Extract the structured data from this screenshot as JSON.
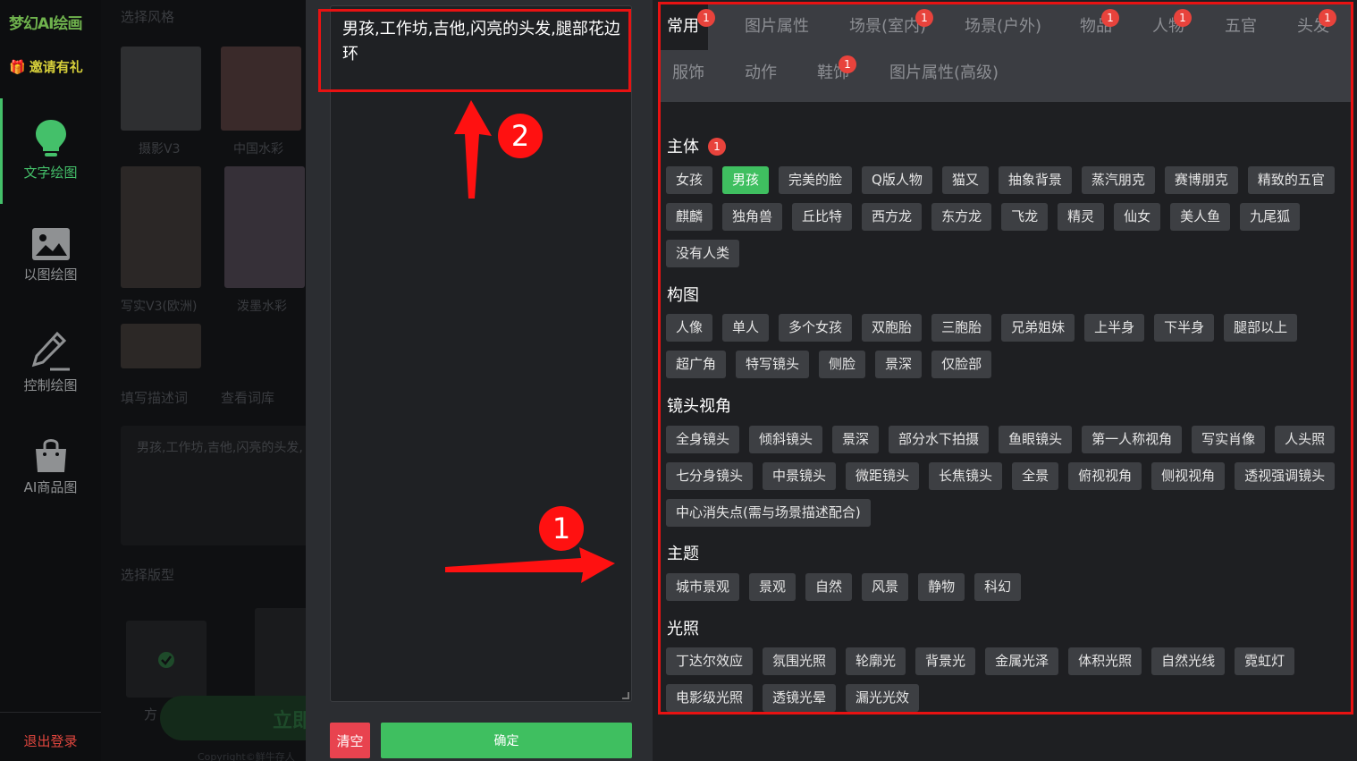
{
  "sidebar": {
    "logo": "梦幻AI绘画",
    "invite": "邀请有礼",
    "items": [
      {
        "label": "文字绘图",
        "icon": "lightbulb-icon"
      },
      {
        "label": "以图绘图",
        "icon": "image-icon"
      },
      {
        "label": "控制绘图",
        "icon": "pencil-icon"
      },
      {
        "label": "AI商品图",
        "icon": "shopping-bag-icon"
      }
    ],
    "logout": "退出登录"
  },
  "background": {
    "select_style": "选择风格",
    "styles": [
      "摄影V3",
      "中国水彩",
      "写实V3(欧洲)",
      "泼墨水彩"
    ],
    "fill_desc": "填写描述词",
    "view_lexicon": "查看词库",
    "prompt_preview": "男孩,工作坊,吉他,闪亮的头发,",
    "select_layout": "选择版型",
    "layout_option": "方",
    "generate_btn": "立即",
    "copyright": "Copyright©鲜牛存人"
  },
  "editor": {
    "prompt": "男孩,工作坊,吉他,闪亮的头发,腿部花边环",
    "clear": "清空",
    "confirm": "确定"
  },
  "tabs": [
    {
      "label": "常用",
      "badge": "1",
      "active": true
    },
    {
      "label": "图片属性"
    },
    {
      "label": "场景(室内)",
      "badge": "1"
    },
    {
      "label": "场景(户外)"
    },
    {
      "label": "物品",
      "badge": "1"
    },
    {
      "label": "人物",
      "badge": "1"
    },
    {
      "label": "五官"
    },
    {
      "label": "头发",
      "badge": "1"
    },
    {
      "label": "服饰"
    },
    {
      "label": "动作"
    },
    {
      "label": "鞋饰",
      "badge": "1"
    },
    {
      "label": "图片属性(高级)"
    }
  ],
  "sections": [
    {
      "title": "主体",
      "badge": "1",
      "selected": "男孩",
      "tags": [
        "女孩",
        "男孩",
        "完美的脸",
        "Q版人物",
        "猫又",
        "抽象背景",
        "蒸汽朋克",
        "赛博朋克",
        "精致的五官",
        "麒麟",
        "独角兽",
        "丘比特",
        "西方龙",
        "东方龙",
        "飞龙",
        "精灵",
        "仙女",
        "美人鱼",
        "九尾狐",
        "没有人类"
      ]
    },
    {
      "title": "构图",
      "tags": [
        "人像",
        "单人",
        "多个女孩",
        "双胞胎",
        "三胞胎",
        "兄弟姐妹",
        "上半身",
        "下半身",
        "腿部以上",
        "超广角",
        "特写镜头",
        "侧脸",
        "景深",
        "仅脸部"
      ]
    },
    {
      "title": "镜头视角",
      "tags": [
        "全身镜头",
        "倾斜镜头",
        "景深",
        "部分水下拍摄",
        "鱼眼镜头",
        "第一人称视角",
        "写实肖像",
        "人头照",
        "七分身镜头",
        "中景镜头",
        "微距镜头",
        "长焦镜头",
        "全景",
        "俯视视角",
        "侧视视角",
        "透视强调镜头",
        "中心消失点(需与场景描述配合)"
      ]
    },
    {
      "title": "主题",
      "tags": [
        "城市景观",
        "景观",
        "自然",
        "风景",
        "静物",
        "科幻"
      ]
    },
    {
      "title": "光照",
      "tags": [
        "丁达尔效应",
        "氛围光照",
        "轮廓光",
        "背景光",
        "金属光泽",
        "体积光照",
        "自然光线",
        "霓虹灯",
        "电影级光照",
        "透镜光晕",
        "漏光光效"
      ]
    }
  ],
  "annotations": {
    "marker_1": "1",
    "marker_2": "2",
    "color": "#ff1111"
  }
}
